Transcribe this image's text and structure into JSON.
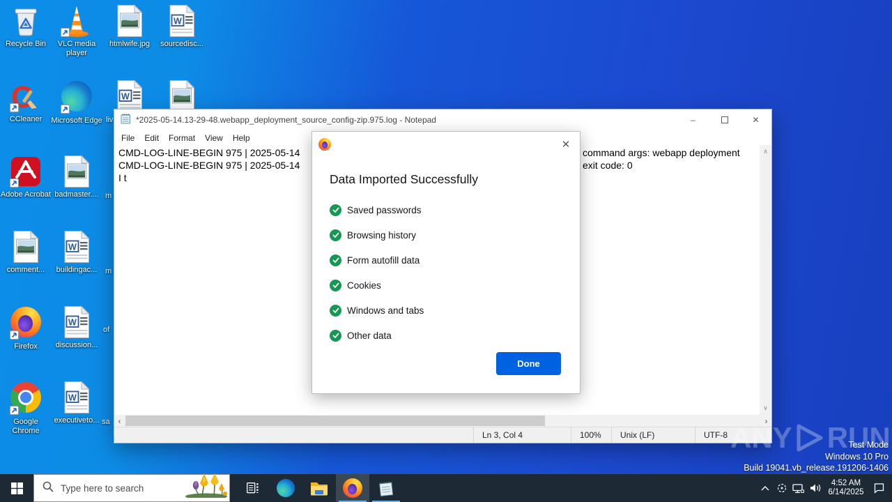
{
  "desktop": {
    "icons": [
      {
        "label": "Recycle Bin",
        "icon": "recycle-bin",
        "col": 0,
        "row": 0,
        "shortcut": false
      },
      {
        "label": "VLC media player",
        "icon": "vlc",
        "col": 1,
        "row": 0,
        "shortcut": true
      },
      {
        "label": "htmlwife.jpg",
        "icon": "image-file",
        "col": 2,
        "row": 0,
        "shortcut": false
      },
      {
        "label": "sourcedisc...",
        "icon": "word-file",
        "col": 3,
        "row": 0,
        "shortcut": false
      },
      {
        "label": "CCleaner",
        "icon": "ccleaner",
        "col": 0,
        "row": 1,
        "shortcut": true
      },
      {
        "label": "Microsoft Edge",
        "icon": "edge",
        "col": 1,
        "row": 1,
        "shortcut": true
      },
      {
        "label": "",
        "icon": "word-file",
        "col": 2,
        "row": 1,
        "shortcut": false
      },
      {
        "label": "",
        "icon": "image-file",
        "col": 3,
        "row": 1,
        "shortcut": false
      },
      {
        "label": "Adobe Acrobat",
        "icon": "acrobat",
        "col": 0,
        "row": 2,
        "shortcut": true
      },
      {
        "label": "badmaster....",
        "icon": "image-file",
        "col": 1,
        "row": 2,
        "shortcut": false
      },
      {
        "label": "comment...",
        "icon": "image-file",
        "col": 0,
        "row": 3,
        "shortcut": false
      },
      {
        "label": "buildingac...",
        "icon": "word-file",
        "col": 1,
        "row": 3,
        "shortcut": false
      },
      {
        "label": "Firefox",
        "icon": "firefox",
        "col": 0,
        "row": 4,
        "shortcut": true
      },
      {
        "label": "discussion...",
        "icon": "word-file",
        "col": 1,
        "row": 4,
        "shortcut": false
      },
      {
        "label": "Google Chrome",
        "icon": "chrome",
        "col": 0,
        "row": 5,
        "shortcut": true
      },
      {
        "label": "executiveto...",
        "icon": "word-file",
        "col": 1,
        "row": 5,
        "shortcut": false
      }
    ],
    "partial_labels": [
      "liv",
      "m",
      "m",
      "of",
      "sa"
    ]
  },
  "notepad": {
    "title": "*2025-05-14.13-29-48.webapp_deployment_source_config-zip.975.log - Notepad",
    "menus": [
      "File",
      "Edit",
      "Format",
      "View",
      "Help"
    ],
    "lines": {
      "l1": "CMD-LOG-LINE-BEGIN 975 | 2025-05-14",
      "l2": "CMD-LOG-LINE-BEGIN 975 | 2025-05-14",
      "l3": "I t",
      "r1": "command args: webapp deployment",
      "r2": "exit code: 0"
    },
    "status": {
      "ln_col": "Ln 3, Col 4",
      "zoom": "100%",
      "eol": "Unix (LF)",
      "encoding": "UTF-8"
    }
  },
  "dialog": {
    "title": "Data Imported Successfully",
    "items": [
      "Saved passwords",
      "Browsing history",
      "Form autofill data",
      "Cookies",
      "Windows and tabs",
      "Other data"
    ],
    "done_label": "Done",
    "accent_color": "#0062e0",
    "check_color": "#129a52"
  },
  "taskbar": {
    "search_placeholder": "Type here to search",
    "clock_time": "4:52 AM",
    "clock_date": "6/14/2025"
  },
  "watermark": {
    "brand_any": "ANY",
    "brand_run": "RUN",
    "lines": [
      "Test Mode",
      "Windows 10 Pro",
      "Build 19041.vb_release.191206-1406"
    ]
  }
}
